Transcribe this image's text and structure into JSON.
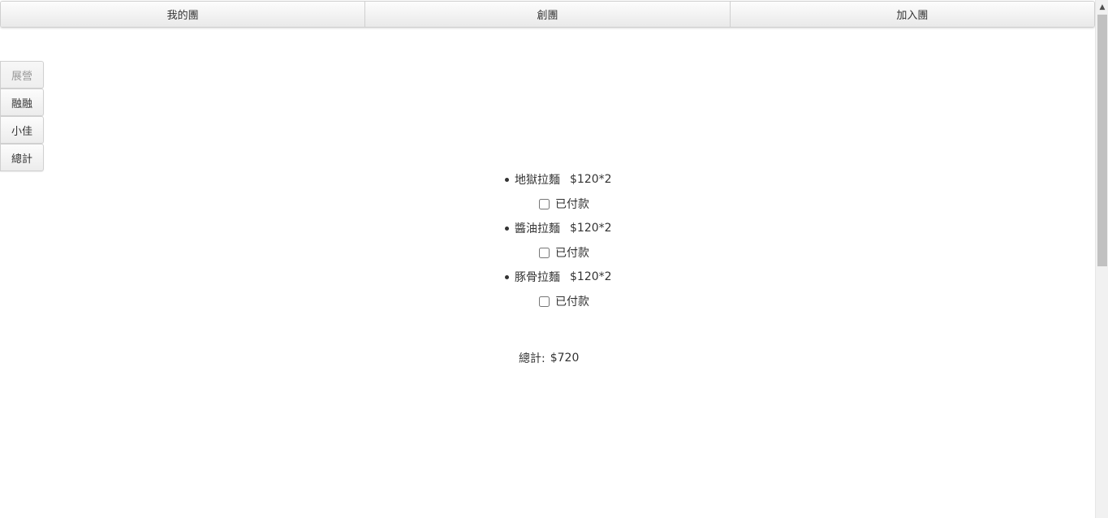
{
  "top_tabs": [
    {
      "label": "我的團"
    },
    {
      "label": "創團"
    },
    {
      "label": "加入團"
    }
  ],
  "side_nav": [
    {
      "label": "展營",
      "active": true
    },
    {
      "label": "融融",
      "active": false
    },
    {
      "label": "小佳",
      "active": false
    },
    {
      "label": "總計",
      "active": false
    }
  ],
  "orders": [
    {
      "name": "地獄拉麵",
      "price": "$120*2",
      "paid_label": "已付款",
      "paid": false
    },
    {
      "name": "醬油拉麵",
      "price": "$120*2",
      "paid_label": "已付款",
      "paid": false
    },
    {
      "name": "豚骨拉麵",
      "price": "$120*2",
      "paid_label": "已付款",
      "paid": false
    }
  ],
  "total": {
    "label": "總計:",
    "value": "$720"
  },
  "scrollbar": {
    "up_icon": "chevron-up-icon"
  }
}
